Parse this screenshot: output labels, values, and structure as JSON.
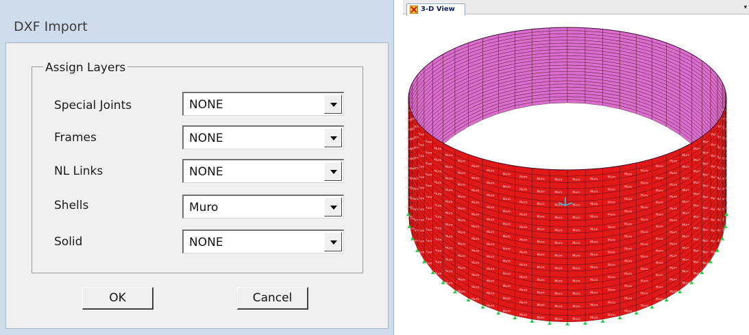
{
  "dialog": {
    "title": "DXF Import",
    "group_label": "Assign Layers",
    "rows": [
      {
        "label": "Special Joints",
        "value": "NONE"
      },
      {
        "label": "Frames",
        "value": "NONE"
      },
      {
        "label": "NL Links",
        "value": "NONE"
      },
      {
        "label": "Shells",
        "value": "Muro"
      },
      {
        "label": "Solid",
        "value": "NONE"
      }
    ],
    "ok_label": "OK",
    "cancel_label": "Cancel"
  },
  "view": {
    "tab_label": "3-D View",
    "tab_icon": "3d-view-icon",
    "dropdown_icon": "chevron-down-icon",
    "mesh_label": "Muro",
    "colors": {
      "inner_wall": "#d96ed0",
      "outer_wall": "#e01818",
      "mesh_line": "#4a1010",
      "support": "#22cc44",
      "axis": "#33ccee"
    }
  }
}
